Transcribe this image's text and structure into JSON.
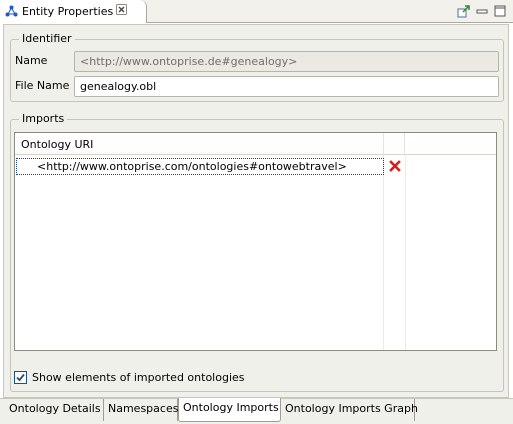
{
  "view": {
    "title": "Entity Properties",
    "icons": {
      "tab": "hierarchy-icon",
      "close": "close-icon",
      "actions": [
        "pin-icon",
        "minimize-icon",
        "maximize-icon"
      ]
    }
  },
  "identifier": {
    "legend": "Identifier",
    "name_label": "Name",
    "name_value": "<http://www.ontoprise.de#genealogy>",
    "file_label": "File Name",
    "file_value": "genealogy.obl"
  },
  "imports": {
    "legend": "Imports",
    "column_header": "Ontology URI",
    "rows": [
      {
        "uri": "<http://www.ontoprise.com/ontologies#ontowebtravel>",
        "action_icon": "delete-icon"
      }
    ]
  },
  "show_imported": {
    "label": "Show elements of imported ontologies",
    "checked": true
  },
  "bottom_tabs": [
    {
      "label": "Ontology Details",
      "active": false
    },
    {
      "label": "Namespaces",
      "active": false
    },
    {
      "label": "Ontology Imports",
      "active": true
    },
    {
      "label": "Ontology Imports Graph",
      "active": false
    }
  ],
  "colors": {
    "delete_red": "#d42020",
    "tab_icon_blue": "#2457c9",
    "checkmark": "#1c5180"
  }
}
